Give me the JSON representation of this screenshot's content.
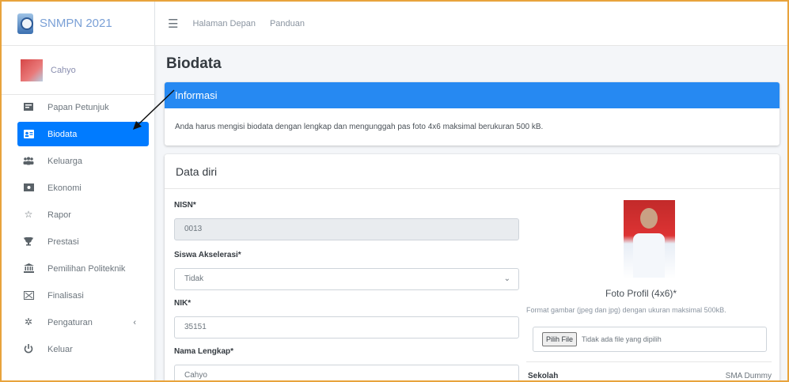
{
  "brand": {
    "title": "SNMPN 2021",
    "logo_icon": "snmpn-logo-icon"
  },
  "user": {
    "name": "Cahyo"
  },
  "sidebar": {
    "items": [
      {
        "label": "Papan Petunjuk",
        "icon": "board-icon"
      },
      {
        "label": "Biodata",
        "icon": "id-card-icon",
        "active": true
      },
      {
        "label": "Keluarga",
        "icon": "users-icon"
      },
      {
        "label": "Ekonomi",
        "icon": "money-icon"
      },
      {
        "label": "Rapor",
        "icon": "star-icon"
      },
      {
        "label": "Prestasi",
        "icon": "trophy-icon"
      },
      {
        "label": "Pemilihan Politeknik",
        "icon": "university-icon"
      },
      {
        "label": "Finalisasi",
        "icon": "finalize-icon"
      },
      {
        "label": "Pengaturan",
        "icon": "gear-icon",
        "chevron": "‹"
      },
      {
        "label": "Keluar",
        "icon": "power-icon"
      }
    ]
  },
  "topbar": {
    "menu_icon": "hamburger-icon",
    "links": [
      "Halaman Depan",
      "Panduan"
    ]
  },
  "page": {
    "title": "Biodata"
  },
  "info": {
    "header": "Informasi",
    "body": "Anda harus mengisi biodata dengan lengkap dan mengunggah pas foto 4x6 maksimal berukuran 500 kB."
  },
  "data_diri": {
    "header": "Data diri",
    "fields": {
      "nisn": {
        "label": "NISN*",
        "value": "0013"
      },
      "akselerasi": {
        "label": "Siswa Akselerasi*",
        "value": "Tidak"
      },
      "nik": {
        "label": "NIK*",
        "value": "35151"
      },
      "nama": {
        "label": "Nama Lengkap*",
        "value": "Cahyo"
      }
    },
    "photo": {
      "label": "Foto Profil (4x6)*",
      "hint": "Format gambar (jpeg dan jpg) dengan ukuran maksimal 500kB.",
      "file_button": "Pilih File",
      "file_status": "Tidak ada file yang dipilih"
    },
    "sekolah": {
      "label": "Sekolah",
      "value": "SMA Dummy"
    }
  },
  "colors": {
    "primary": "#007bff",
    "info_header": "#2689f2",
    "frame": "#e8a33c"
  }
}
